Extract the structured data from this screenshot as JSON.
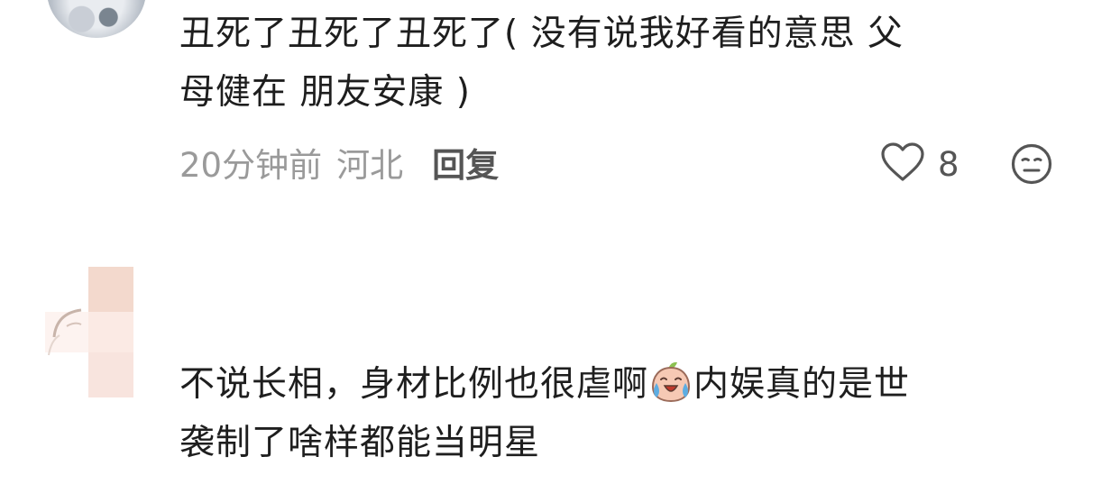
{
  "comments": [
    {
      "text": "丑死了丑死了丑死了( 没有说我好看的意思 父\n母健在 朋友安康 )",
      "time": "20分钟前",
      "location": "河北",
      "reply_label": "回复",
      "like_count": "8",
      "icons": {
        "like": "heart-outline-icon",
        "dislike": "meh-face-icon"
      }
    },
    {
      "text_before_emoji": "不说长相，身材比例也很虐啊",
      "emoji": "crying-peach-emoji",
      "text_after_emoji": "内娱真的是世\n袭制了啥样都能当明星"
    }
  ],
  "colors": {
    "text": "#1e1e1e",
    "meta": "#9a9a9a",
    "action": "#555555",
    "background": "#ffffff"
  }
}
